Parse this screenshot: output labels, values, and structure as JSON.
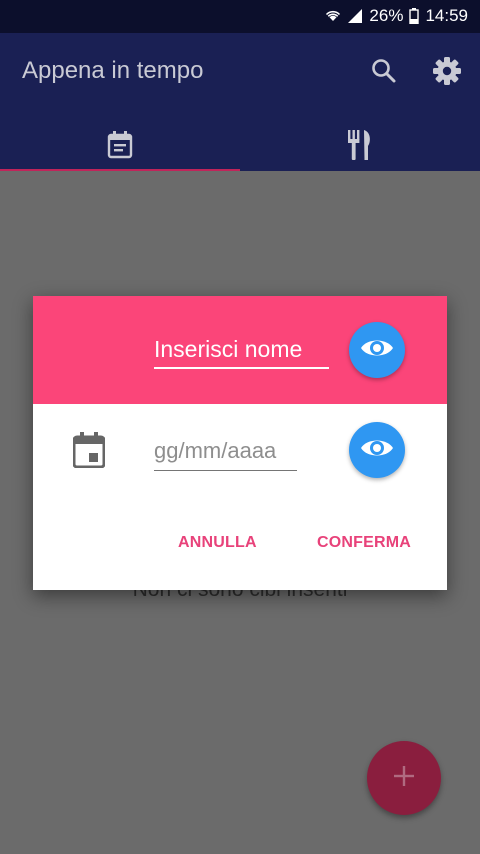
{
  "status_bar": {
    "battery": "26%",
    "time": "14:59",
    "icons": [
      "wifi-icon",
      "signal-icon",
      "battery-icon"
    ]
  },
  "app_bar": {
    "title": "Appena in tempo",
    "actions": [
      "search-icon",
      "settings-icon"
    ]
  },
  "tabs": [
    {
      "icon": "calendar-list-icon",
      "selected": true
    },
    {
      "icon": "fork-knife-icon",
      "selected": false
    }
  ],
  "main": {
    "empty_message": "Non ci sono cibi inseriti"
  },
  "dialog": {
    "name_placeholder": "Inserisci nome",
    "date_placeholder": "gg/mm/aaaa",
    "cancel_label": "ANNULLA",
    "confirm_label": "CONFERMA"
  },
  "colors": {
    "app_bar": "#1a2054",
    "dialog_header": "#fb4579",
    "eye_button": "#2f97f2",
    "accent": "#e8427a",
    "fab": "#8a1e3e"
  }
}
